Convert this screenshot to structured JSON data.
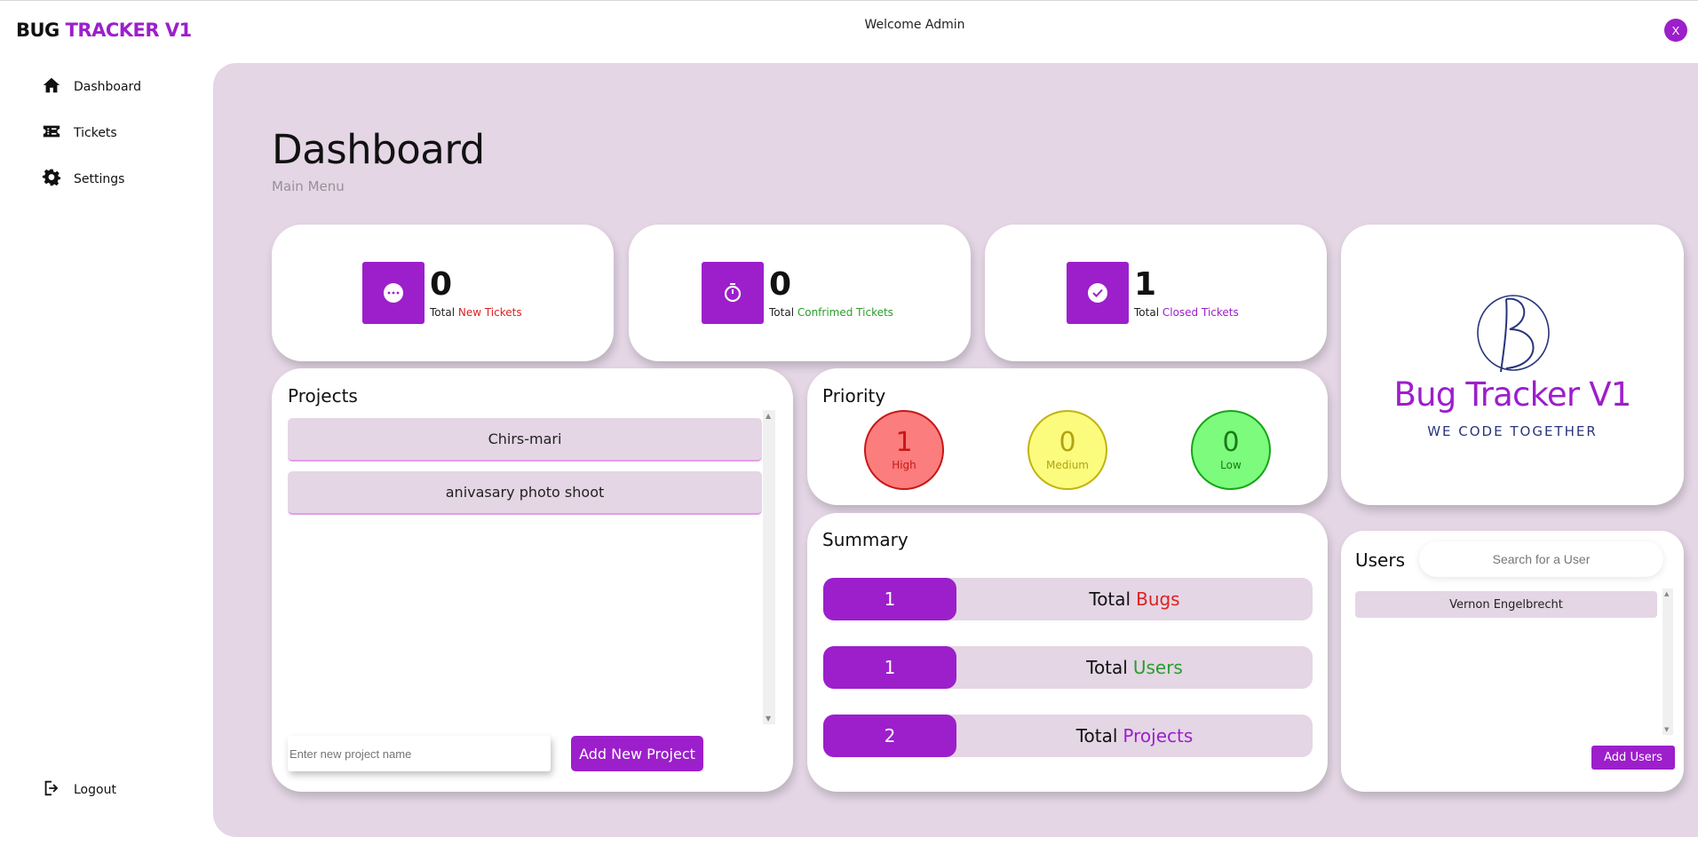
{
  "brand": {
    "part1": "BUG ",
    "part2": "TRACKER V1"
  },
  "header": {
    "welcome": "Welcome Admin",
    "close_label": "X"
  },
  "sidebar": {
    "items": [
      {
        "label": "Dashboard",
        "icon": "home-icon"
      },
      {
        "label": "Tickets",
        "icon": "ticket-icon"
      },
      {
        "label": "Settings",
        "icon": "gear-icon"
      }
    ],
    "logout": {
      "label": "Logout",
      "icon": "logout-icon"
    }
  },
  "page": {
    "title": "Dashboard",
    "subtitle": "Main Menu"
  },
  "stats": [
    {
      "value": "0",
      "prefix": "Total",
      "label": "New Tickets",
      "icon": "chat-icon"
    },
    {
      "value": "0",
      "prefix": "Total",
      "label": "Confrimed Tickets",
      "icon": "stopwatch-icon"
    },
    {
      "value": "1",
      "prefix": "Total",
      "label": "Closed Tickets",
      "icon": "check-icon"
    }
  ],
  "projects": {
    "title": "Projects",
    "items": [
      "Chirs-mari",
      "anivasary photo shoot"
    ],
    "input_placeholder": "Enter new project name",
    "add_button": "Add New Project"
  },
  "priority": {
    "title": "Priority",
    "levels": [
      {
        "value": "1",
        "label": "High"
      },
      {
        "value": "0",
        "label": "Medium"
      },
      {
        "value": "0",
        "label": "Low"
      }
    ]
  },
  "summary": {
    "title": "Summary",
    "rows": [
      {
        "value": "1",
        "prefix": "Total",
        "label": "Bugs"
      },
      {
        "value": "1",
        "prefix": "Total",
        "label": "Users"
      },
      {
        "value": "2",
        "prefix": "Total",
        "label": "Projects"
      }
    ]
  },
  "logo": {
    "name": "Bug Tracker V1",
    "tagline": "WE CODE TOGETHER"
  },
  "users": {
    "title": "Users",
    "search_placeholder": "Search for a User",
    "items": [
      "Vernon Engelbrecht"
    ],
    "add_button": "Add Users"
  },
  "colors": {
    "accent": "#9c1fcb",
    "panel": "#e4d6e5",
    "red": "#e02020",
    "green": "#2a9d2a",
    "high": "#fb7d7d",
    "medium": "#fbfb7d",
    "low": "#7dfb7d"
  }
}
